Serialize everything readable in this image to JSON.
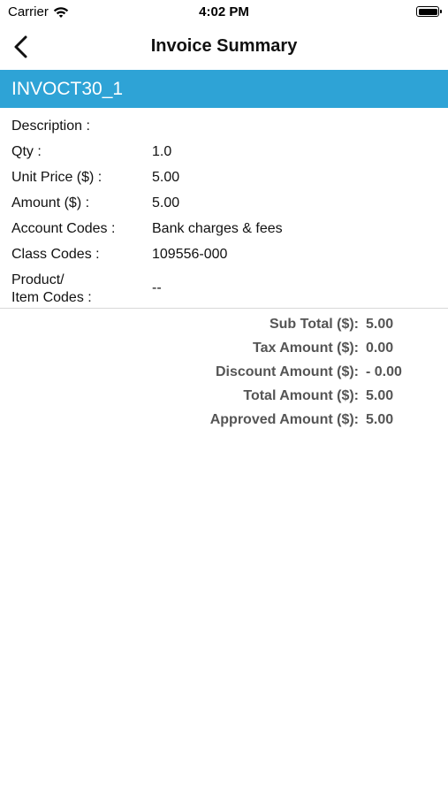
{
  "status_bar": {
    "carrier": "Carrier",
    "time": "4:02 PM",
    "battery_level": 1.0
  },
  "nav": {
    "title": "Invoice Summary",
    "back_icon": "chevron-left-icon"
  },
  "invoice": {
    "id": "INVOCT30_1",
    "header_color": "#2ea3d6"
  },
  "details": {
    "description_label": "Description :",
    "description_value": "",
    "qty_label": "Qty :",
    "qty_value": "1.0",
    "unit_price_label": "Unit Price ($) :",
    "unit_price_value": "5.00",
    "amount_label": "Amount ($) :",
    "amount_value": "5.00",
    "account_codes_label": "Account Codes :",
    "account_codes_value": "Bank charges & fees",
    "class_codes_label": "Class Codes :",
    "class_codes_value": "109556-000",
    "product_label_line1": "Product/",
    "product_label_line2": "Item Codes :",
    "product_value": "--"
  },
  "totals": {
    "sub_total_label": "Sub Total ($):",
    "sub_total_value": "5.00",
    "tax_label": "Tax Amount ($):",
    "tax_value": "0.00",
    "discount_label": "Discount Amount ($):",
    "discount_value": "- 0.00",
    "total_label": "Total Amount ($):",
    "total_value": "5.00",
    "approved_label": "Approved Amount ($):",
    "approved_value": "5.00"
  }
}
